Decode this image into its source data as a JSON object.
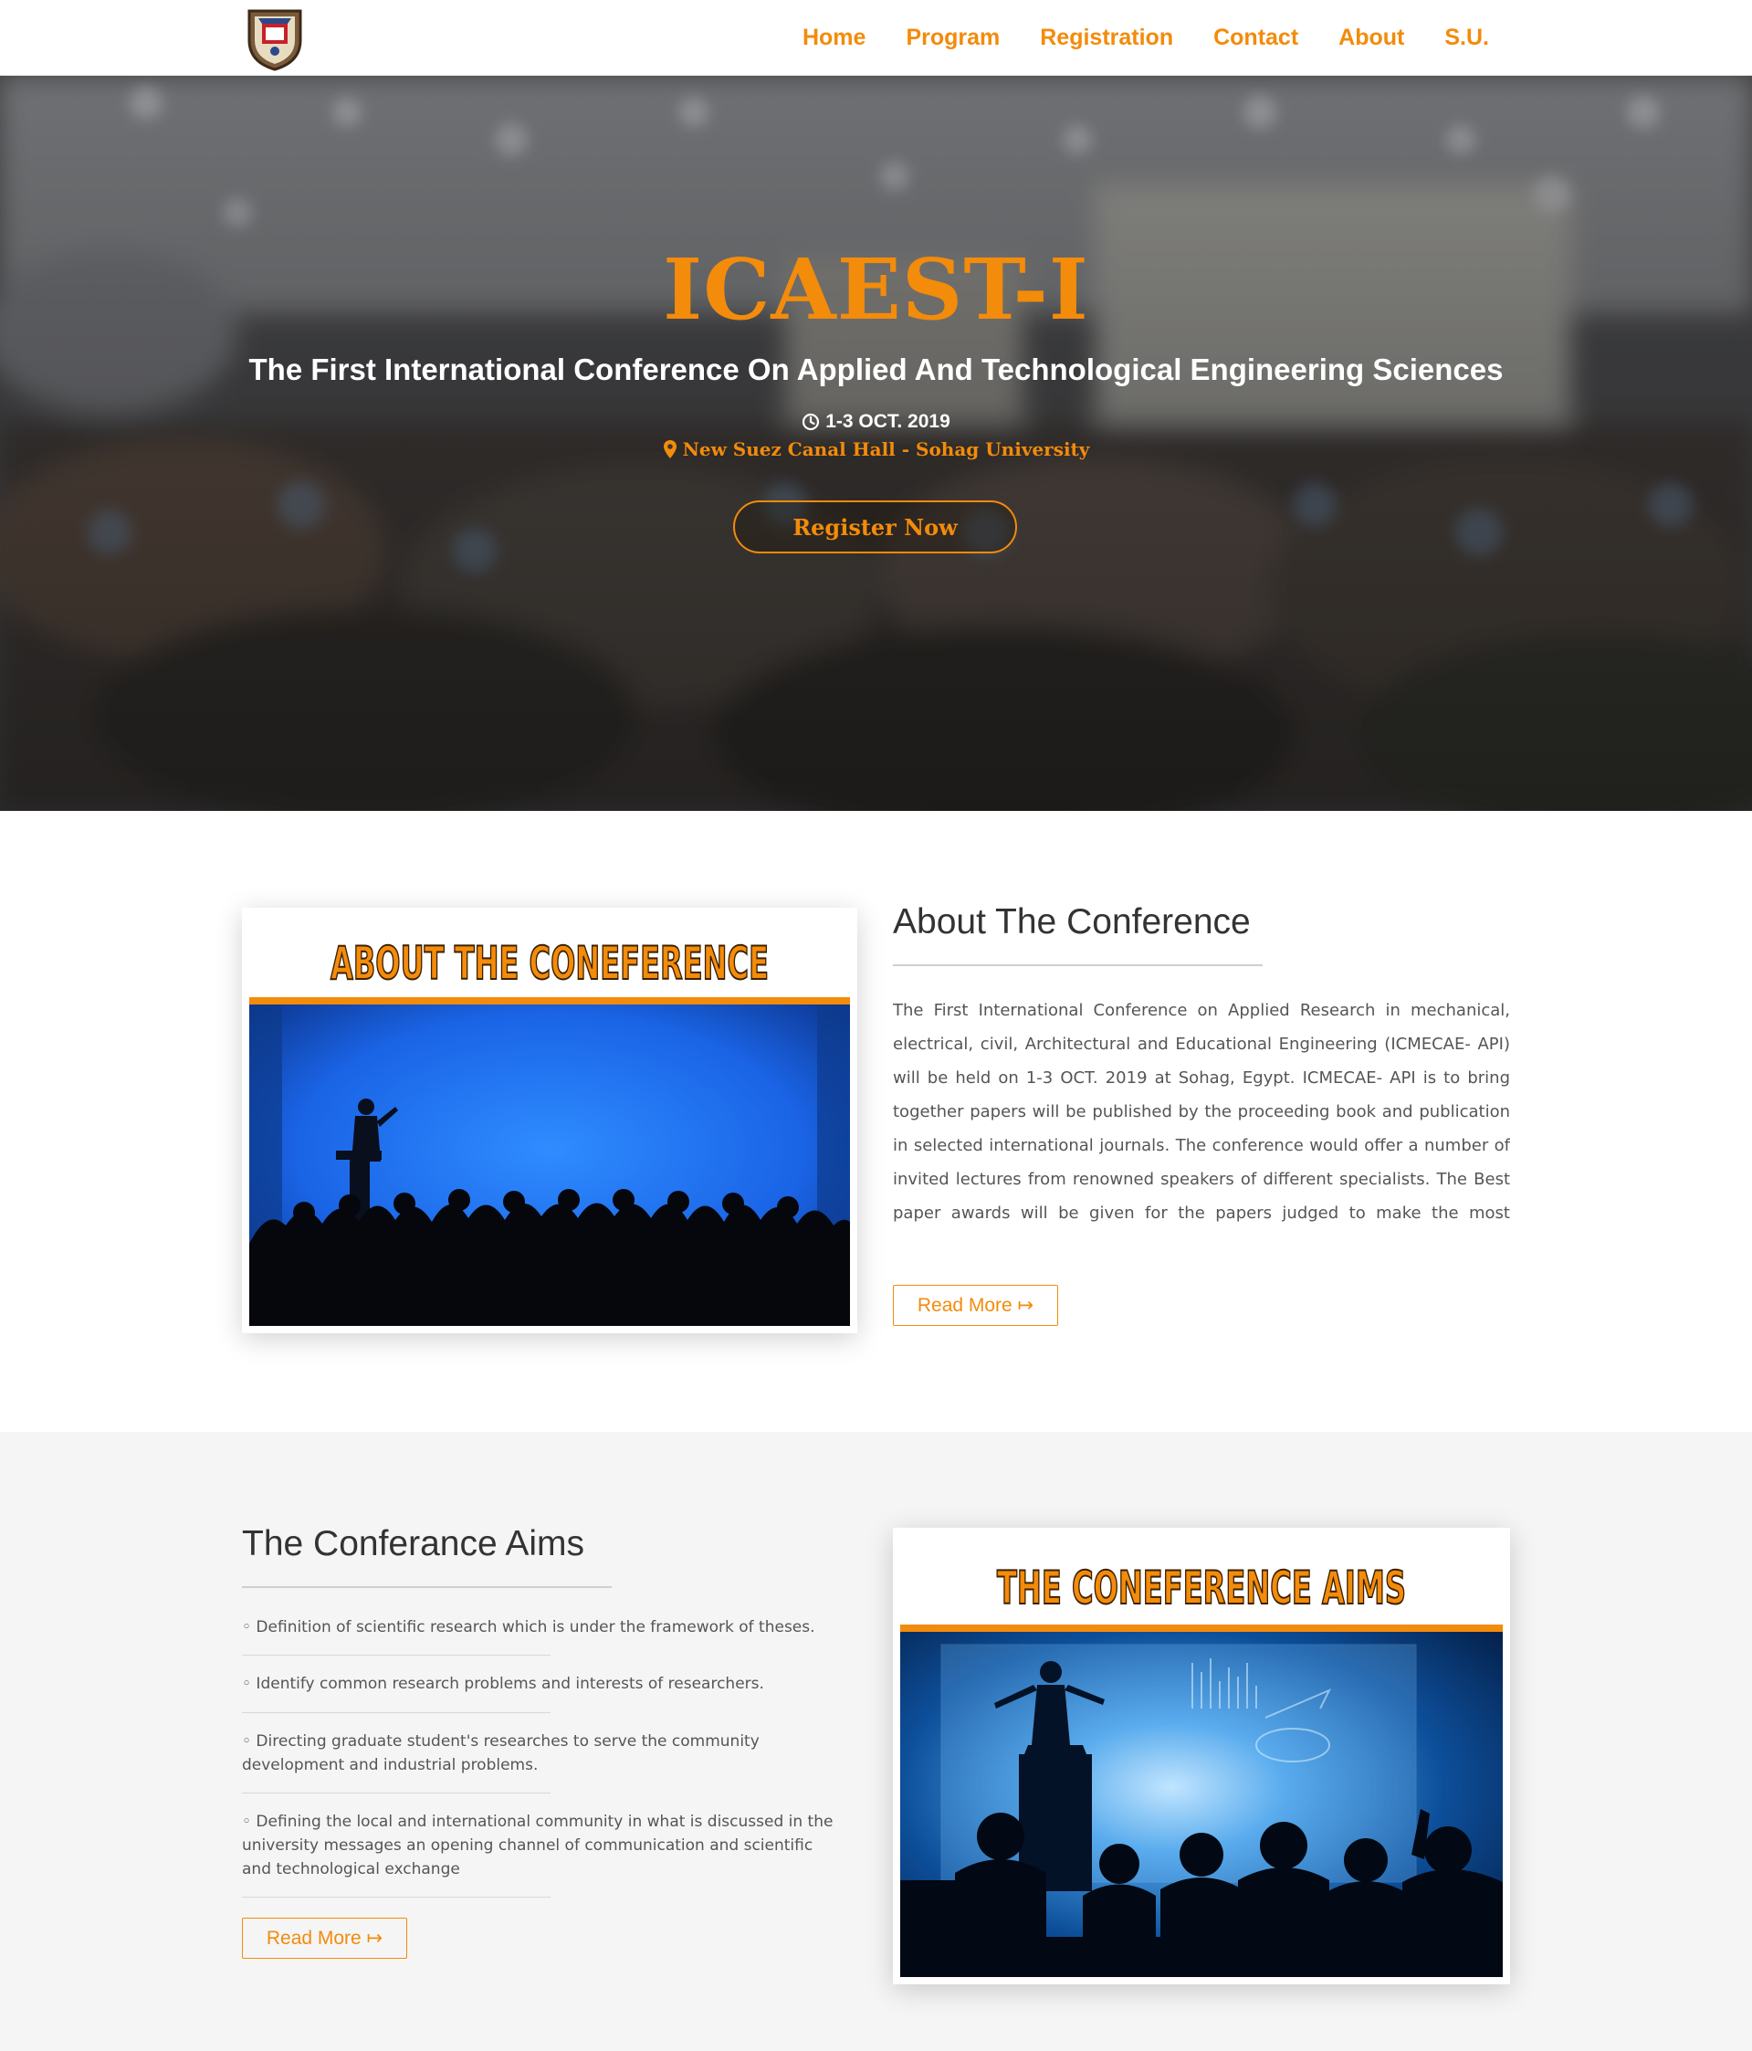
{
  "nav": {
    "logo_alt": "Sohag University logo",
    "links": [
      "Home",
      "Program",
      "Registration",
      "Contact",
      "About",
      "S.U."
    ]
  },
  "hero": {
    "title": "ICAEST-I",
    "subtitle": "The First International Conference On Applied And Technological Engineering Sciences",
    "date": "1-3 OCT. 2019",
    "date_icon": "clock-icon",
    "venue": "New Suez Canal Hall - Sohag University",
    "venue_icon": "map-marker-icon",
    "register_label": "Register Now"
  },
  "about": {
    "image_banner": "ABOUT THE CONEFERENCE",
    "heading": "About The Conference",
    "text": "The First International Conference on Applied Research in mechanical, electrical, civil, Architectural and Educational Engineering (ICMECAE- API) will be held on 1-3 OCT. 2019 at Sohag, Egypt. ICMECAE- API is to bring together papers will be published by the proceeding book and publication in selected international journals. The conference would offer a number of invited lectures from renowned speakers of different specialists. The Best paper awards will be given for the papers judged to make the most significant contribution to the conference. All submissions to the conference will be",
    "read_more": "Read More ↦"
  },
  "aims": {
    "heading": "The Conferance Aims",
    "items": [
      "◦ Definition of scientific research which is under the framework of theses.",
      "◦ Identify common research problems and interests of researchers.",
      "◦ Directing graduate student's researches to serve the community development and industrial problems.",
      "◦ Defining the local and international community in what is discussed in the university messages an opening channel of communication and scientific and technological exchange"
    ],
    "image_banner": "THE CONEFERENCE AIMS",
    "read_more": "Read More ↦"
  },
  "colors": {
    "accent": "#f38b0b",
    "hero_overlay": "#2c2a29",
    "section_gray": "#f5f5f5",
    "heading_text": "#333333",
    "body_text": "#555555",
    "stage_blue": "#1a64e6"
  }
}
